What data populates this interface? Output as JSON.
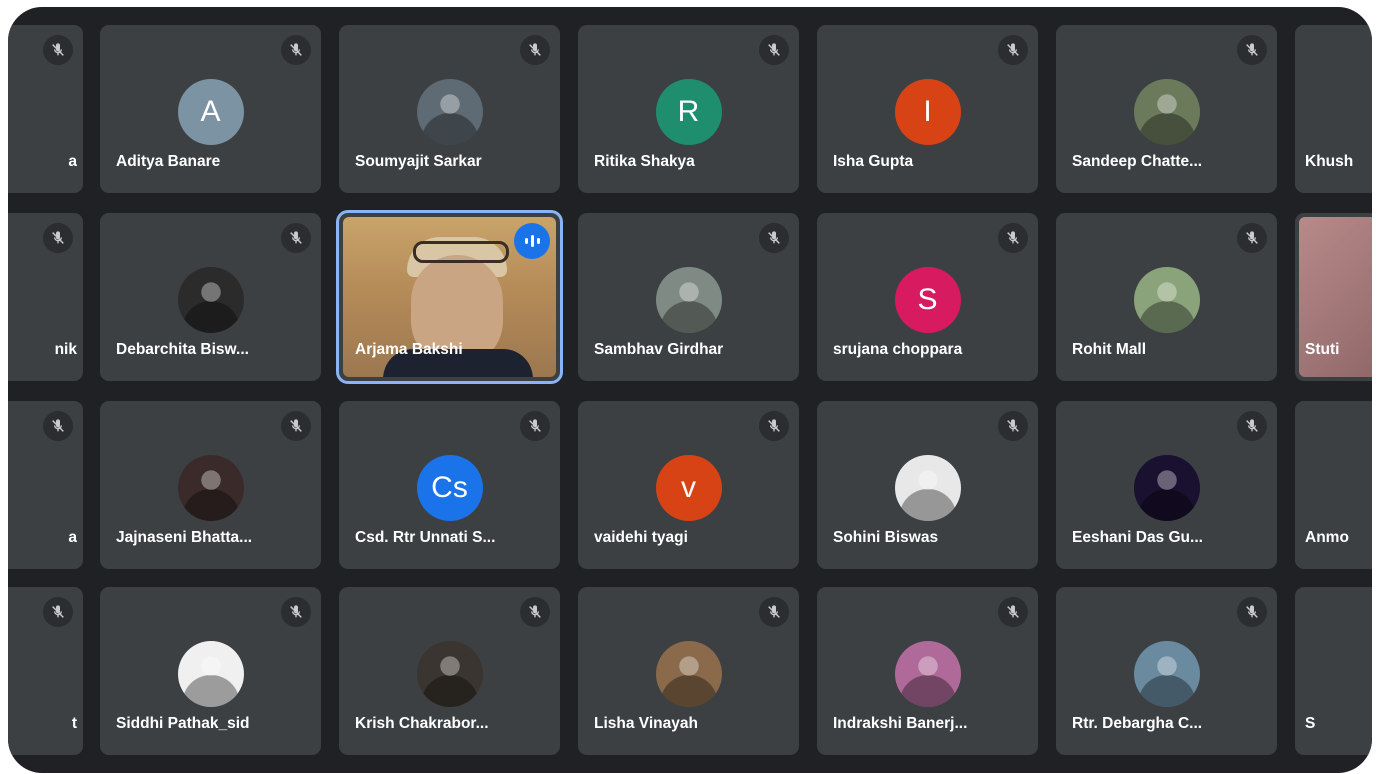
{
  "meeting": {
    "participants": [
      {
        "row": 0,
        "col": 0,
        "name": "a",
        "avatar": "",
        "avatar_color": "#3c4043",
        "kind": "none"
      },
      {
        "row": 0,
        "col": 1,
        "name": "Aditya Banare",
        "avatar": "A",
        "avatar_color": "#7c93a3",
        "kind": "letter"
      },
      {
        "row": 0,
        "col": 2,
        "name": "Soumyajit Sarkar",
        "avatar": "",
        "avatar_color": "#5f6b74",
        "kind": "photo"
      },
      {
        "row": 0,
        "col": 3,
        "name": "Ritika Shakya",
        "avatar": "R",
        "avatar_color": "#1e8e6e",
        "kind": "letter"
      },
      {
        "row": 0,
        "col": 4,
        "name": "Isha Gupta",
        "avatar": "I",
        "avatar_color": "#d84315",
        "kind": "letter"
      },
      {
        "row": 0,
        "col": 5,
        "name": "Sandeep Chatte...",
        "avatar": "",
        "avatar_color": "#6b7a5a",
        "kind": "photo"
      },
      {
        "row": 0,
        "col": 6,
        "name": "Khush",
        "avatar": "",
        "avatar_color": "#3c4043",
        "kind": "none"
      },
      {
        "row": 1,
        "col": 0,
        "name": "nik",
        "avatar": "",
        "avatar_color": "#3c4043",
        "kind": "none"
      },
      {
        "row": 1,
        "col": 1,
        "name": "Debarchita Bisw...",
        "avatar": "",
        "avatar_color": "#2b2b2b",
        "kind": "photo"
      },
      {
        "row": 1,
        "col": 2,
        "name": "Arjama Bakshi",
        "avatar": "",
        "avatar_color": "#c8a46a",
        "kind": "video"
      },
      {
        "row": 1,
        "col": 3,
        "name": "Sambhav Girdhar",
        "avatar": "",
        "avatar_color": "#7f8a84",
        "kind": "photo"
      },
      {
        "row": 1,
        "col": 4,
        "name": "srujana choppara",
        "avatar": "S",
        "avatar_color": "#d81b60",
        "kind": "letter"
      },
      {
        "row": 1,
        "col": 5,
        "name": "Rohit Mall",
        "avatar": "",
        "avatar_color": "#8aa37a",
        "kind": "photo"
      },
      {
        "row": 1,
        "col": 6,
        "name": "Stuti",
        "avatar": "",
        "avatar_color": "#a07d7d",
        "kind": "video"
      },
      {
        "row": 2,
        "col": 0,
        "name": "a",
        "avatar": "",
        "avatar_color": "#3c4043",
        "kind": "none"
      },
      {
        "row": 2,
        "col": 1,
        "name": "Jajnaseni Bhatta...",
        "avatar": "",
        "avatar_color": "#3a2a2a",
        "kind": "photo"
      },
      {
        "row": 2,
        "col": 2,
        "name": "Csd. Rtr Unnati S...",
        "avatar": "Cs",
        "avatar_color": "#1a73e8",
        "kind": "letter"
      },
      {
        "row": 2,
        "col": 3,
        "name": "vaidehi tyagi",
        "avatar": "v",
        "avatar_color": "#d84315",
        "kind": "letter"
      },
      {
        "row": 2,
        "col": 4,
        "name": "Sohini Biswas",
        "avatar": "",
        "avatar_color": "#e8e8e8",
        "kind": "photo"
      },
      {
        "row": 2,
        "col": 5,
        "name": "Eeshani Das Gu...",
        "avatar": "",
        "avatar_color": "#1a1030",
        "kind": "photo"
      },
      {
        "row": 2,
        "col": 6,
        "name": "Anmo",
        "avatar": "",
        "avatar_color": "#3c4043",
        "kind": "none"
      },
      {
        "row": 3,
        "col": 0,
        "name": "t",
        "avatar": "",
        "avatar_color": "#3c4043",
        "kind": "none"
      },
      {
        "row": 3,
        "col": 1,
        "name": "Siddhi Pathak_sid",
        "avatar": "",
        "avatar_color": "#f0f0f0",
        "kind": "photo"
      },
      {
        "row": 3,
        "col": 2,
        "name": "Krish Chakrabor...",
        "avatar": "",
        "avatar_color": "#3a3530",
        "kind": "photo"
      },
      {
        "row": 3,
        "col": 3,
        "name": "Lisha Vinayah",
        "avatar": "",
        "avatar_color": "#8a6a4a",
        "kind": "photo"
      },
      {
        "row": 3,
        "col": 4,
        "name": "Indrakshi Banerj...",
        "avatar": "",
        "avatar_color": "#b06a9a",
        "kind": "photo"
      },
      {
        "row": 3,
        "col": 5,
        "name": "Rtr. Debargha C...",
        "avatar": "",
        "avatar_color": "#6a8aa0",
        "kind": "photo"
      },
      {
        "row": 3,
        "col": 6,
        "name": "S",
        "avatar": "",
        "avatar_color": "#3c4043",
        "kind": "none"
      }
    ],
    "icons": {
      "mute": "mic-off-icon",
      "speaking": "audio-level-icon"
    }
  }
}
